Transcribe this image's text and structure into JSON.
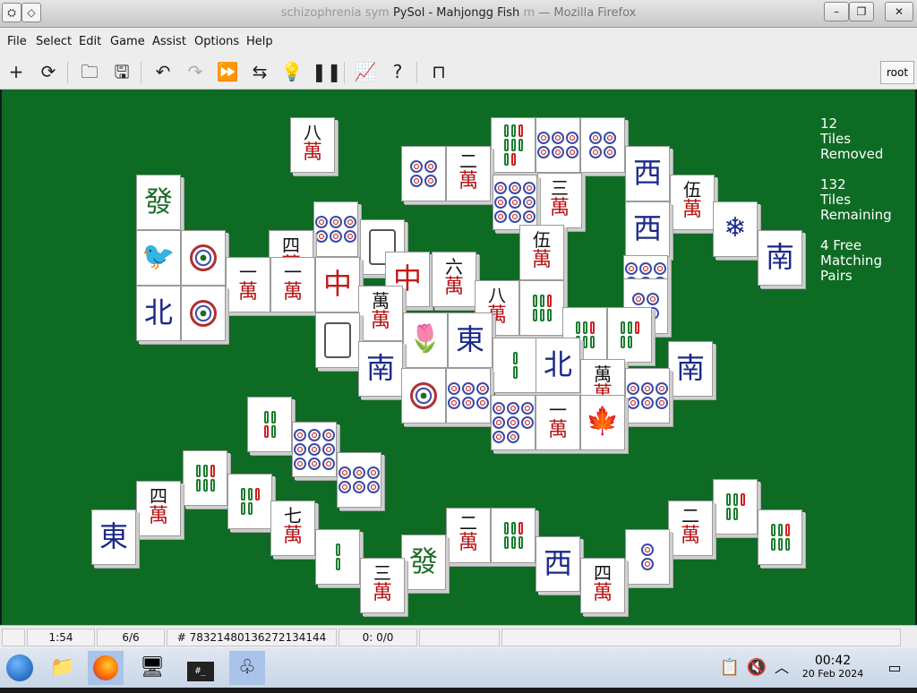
{
  "window": {
    "title_faded": "schizophrenia sym",
    "title_faded_tail": "m",
    "title": "PySol - Mahjongg Fish",
    "title_suffix": "— Mozilla Firefox"
  },
  "menu": [
    "File",
    "Select",
    "Edit",
    "Game",
    "Assist",
    "Options",
    "Help"
  ],
  "toolbar": {
    "icons": [
      "new-icon",
      "restart-icon",
      "open-icon",
      "save-icon",
      "undo-icon",
      "redo-icon",
      "autodrop-icon",
      "shuffle-icon",
      "hint-icon",
      "pause-icon",
      "statistics-icon",
      "help-icon",
      "quit-icon"
    ],
    "player": "root"
  },
  "stats": {
    "removed_count": "12",
    "removed_l1": "Tiles",
    "removed_l2": "Removed",
    "remaining_count": "132",
    "remaining_l1": "Tiles",
    "remaining_l2": "Remaining",
    "free_count": "4 Free",
    "free_l1": "Matching",
    "free_l2": "Pairs"
  },
  "tiles": [
    {
      "k": "wan",
      "n": "八"
    },
    {
      "k": "big",
      "t": "發",
      "c": "#1c6b2a"
    },
    {
      "k": "sym",
      "t": "🐦",
      "c": "#1c6b2a"
    },
    {
      "k": "flower"
    },
    {
      "k": "big",
      "t": "北",
      "c": "#1b2a88"
    },
    {
      "k": "flower"
    },
    {
      "k": "wan",
      "n": "一"
    },
    {
      "k": "wan",
      "n": "四"
    },
    {
      "k": "wan",
      "n": "一"
    },
    {
      "k": "big",
      "t": "中",
      "c": "#c21b1b"
    },
    {
      "k": "blank"
    },
    {
      "k": "dots",
      "v": 6
    },
    {
      "k": "dots",
      "v": 4
    },
    {
      "k": "wan",
      "n": "二"
    },
    {
      "k": "wan",
      "n": "三"
    },
    {
      "k": "bars",
      "v": 8
    },
    {
      "k": "dots",
      "v": 6
    },
    {
      "k": "dots",
      "v": 9
    },
    {
      "k": "dots",
      "v": 4
    },
    {
      "k": "big",
      "t": "西",
      "c": "#1b2a88"
    },
    {
      "k": "wan",
      "n": "伍"
    },
    {
      "k": "sym",
      "t": "❄",
      "c": "#1b2a88"
    },
    {
      "k": "big",
      "t": "南",
      "c": "#1b2a88"
    },
    {
      "k": "big",
      "t": "西",
      "c": "#1b2a88"
    },
    {
      "k": "big",
      "t": "中",
      "c": "#c21b1b"
    },
    {
      "k": "wan",
      "n": "六"
    },
    {
      "k": "wan",
      "n": "伍"
    },
    {
      "k": "wan",
      "n": "八"
    },
    {
      "k": "bars",
      "v": 6
    },
    {
      "k": "big",
      "t": "南",
      "c": "#1b2a88"
    },
    {
      "k": "sym",
      "t": "🌷",
      "c": "#1c6b2a"
    },
    {
      "k": "big",
      "t": "東",
      "c": "#1b2a88"
    },
    {
      "k": "bars",
      "v": 2
    },
    {
      "k": "big",
      "t": "北",
      "c": "#1b2a88"
    },
    {
      "k": "bars",
      "v": 6
    },
    {
      "k": "bars",
      "v": 5
    },
    {
      "k": "big",
      "t": "南",
      "c": "#1b2a88"
    },
    {
      "k": "flower"
    },
    {
      "k": "dots",
      "v": 6
    },
    {
      "k": "dots",
      "v": 8
    },
    {
      "k": "wan",
      "n": "一"
    },
    {
      "k": "sym",
      "t": "🍁",
      "c": "#1c6b2a"
    },
    {
      "k": "wan",
      "n": "萬"
    },
    {
      "k": "dots",
      "v": 6
    },
    {
      "k": "bars",
      "v": 4
    },
    {
      "k": "dots",
      "v": 9
    },
    {
      "k": "bars",
      "v": 6
    },
    {
      "k": "big",
      "t": "東",
      "c": "#1b2a88"
    },
    {
      "k": "wan",
      "n": "四"
    },
    {
      "k": "dots",
      "v": 6
    },
    {
      "k": "bars",
      "v": 5
    },
    {
      "k": "wan",
      "n": "七"
    },
    {
      "k": "bars",
      "v": 2
    },
    {
      "k": "wan",
      "n": "三"
    },
    {
      "k": "big",
      "t": "發",
      "c": "#1c6b2a"
    },
    {
      "k": "wan",
      "n": "二"
    },
    {
      "k": "bars",
      "v": 6
    },
    {
      "k": "big",
      "t": "西",
      "c": "#1b2a88"
    },
    {
      "k": "wan",
      "n": "四"
    },
    {
      "k": "dots",
      "v": 2
    },
    {
      "k": "wan",
      "n": "二"
    },
    {
      "k": "bars",
      "v": 5
    },
    {
      "k": "bars",
      "v": 6
    },
    {
      "k": "blank"
    },
    {
      "k": "wan",
      "n": "萬"
    },
    {
      "k": "dots",
      "v": 9
    },
    {
      "k": "dots",
      "v": 4
    }
  ],
  "statusbar": {
    "time": "1:54",
    "moves": "6/6",
    "seed": "# 78321480136272134144",
    "score": "0: 0/0"
  },
  "taskbar": {
    "clock_time": "00:42",
    "clock_date": "20 Feb 2024"
  }
}
